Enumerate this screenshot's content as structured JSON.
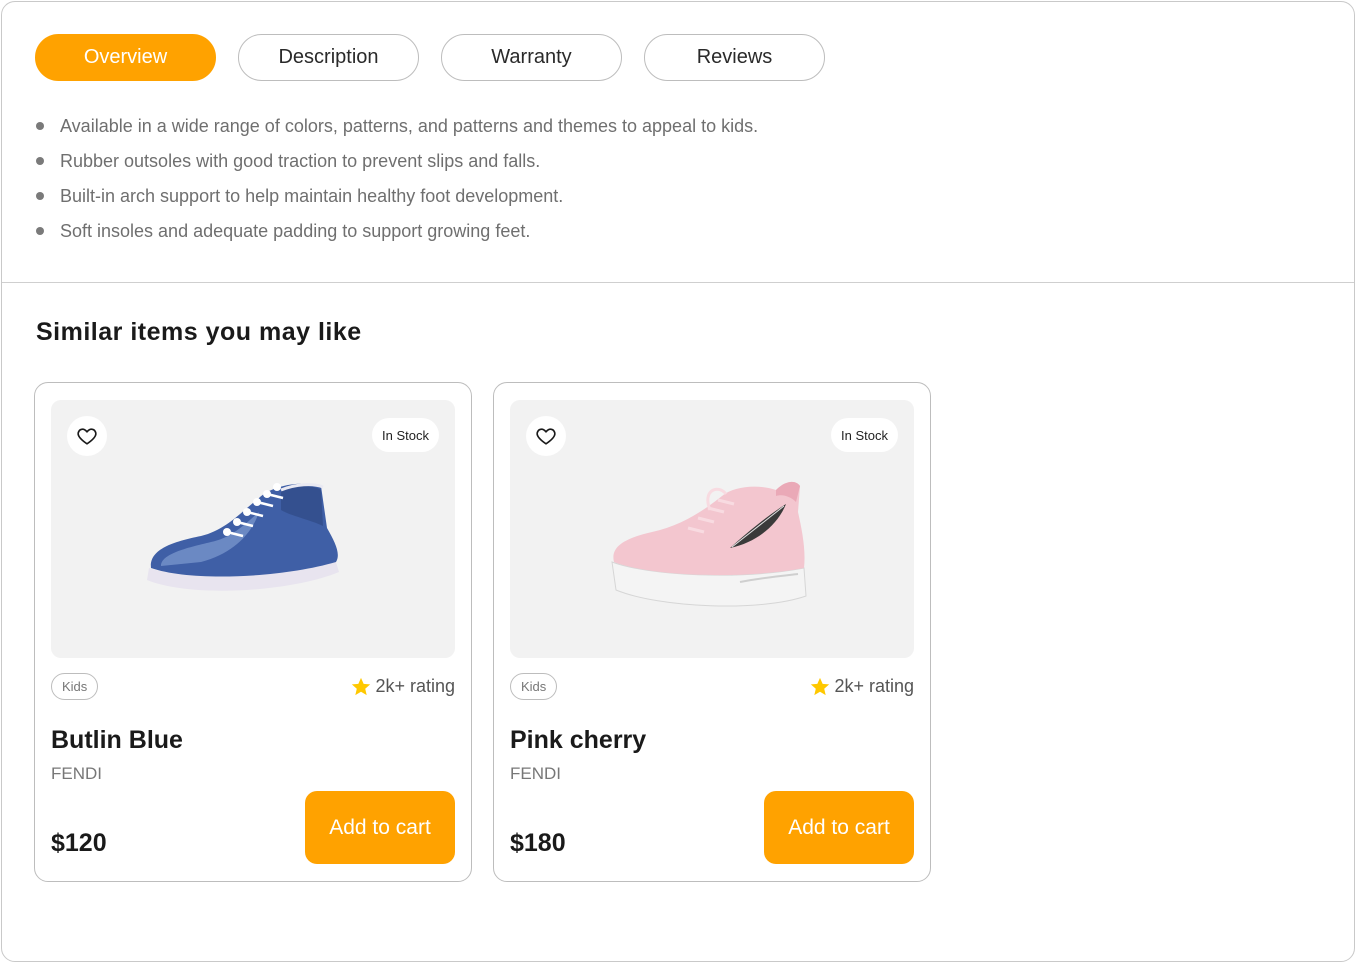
{
  "tabs": [
    {
      "label": "Overview",
      "active": true
    },
    {
      "label": "Description",
      "active": false
    },
    {
      "label": "Warranty",
      "active": false
    },
    {
      "label": "Reviews",
      "active": false
    }
  ],
  "overview_points": [
    "Available in a wide range of colors, patterns, and patterns and themes to appeal to kids.",
    "Rubber outsoles with good traction to prevent slips and falls.",
    "Built-in arch support to help maintain healthy foot development.",
    "Soft insoles and adequate padding to support growing feet."
  ],
  "similar": {
    "title": "Similar items you may like",
    "items": [
      {
        "name": "Butlin Blue",
        "brand": "FENDI",
        "price": "$120",
        "category": "Kids",
        "stock": "In Stock",
        "rating": "2k+ rating",
        "cart_label": "Add to cart",
        "image_icon": "blue-sneaker-image"
      },
      {
        "name": "Pink cherry",
        "brand": "FENDI",
        "price": "$180",
        "category": "Kids",
        "stock": "In Stock",
        "rating": "2k+ rating",
        "cart_label": "Add to cart",
        "image_icon": "pink-sneaker-image"
      }
    ]
  },
  "colors": {
    "accent": "#ffa200",
    "star": "#ffc800",
    "border": "#bdbdbd"
  }
}
